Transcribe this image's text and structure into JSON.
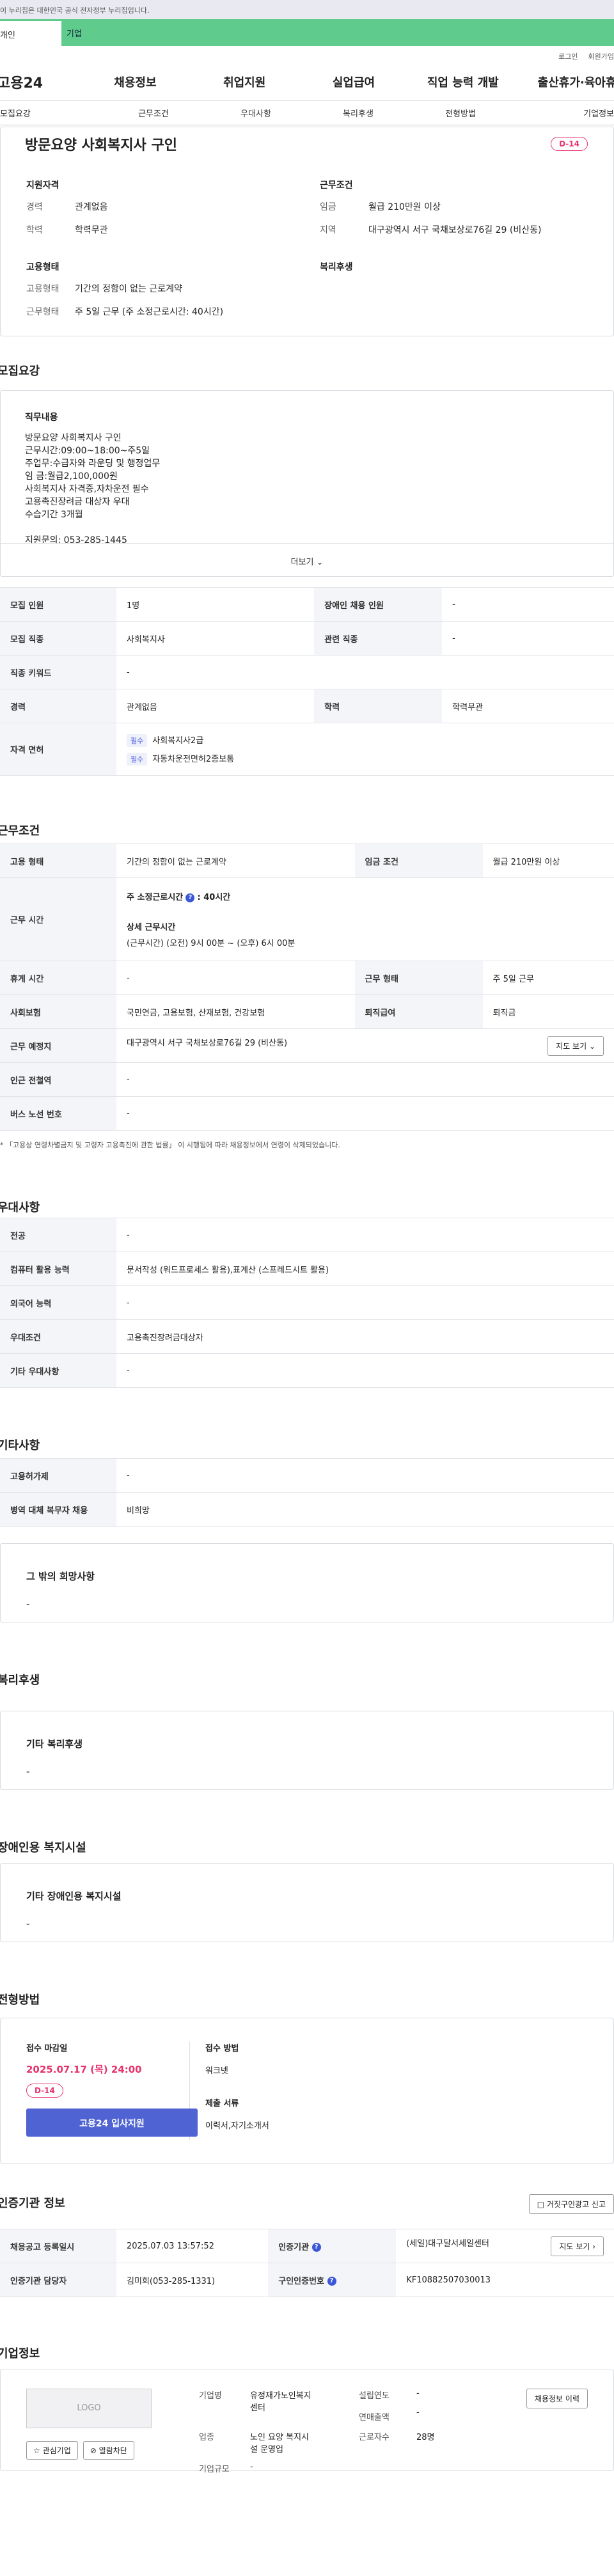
{
  "gov_banner": "이 누리집은 대한민국 공식 전자정부 누리집입니다.",
  "top_tabs": {
    "personal": "개인",
    "company": "기업"
  },
  "util": {
    "login": "로그인",
    "join": "회원가입"
  },
  "gnb": {
    "logo": "고용24",
    "items": [
      "채용정보",
      "취업지원",
      "실업급여",
      "직업 능력 개발",
      "출산휴가·육아휴직"
    ]
  },
  "subnav": [
    "모집요강",
    "근무조건",
    "우대사항",
    "복리후생",
    "전형방법",
    "기업정보"
  ],
  "job": {
    "title": "방문요양 사회복지사 구인",
    "dday": "D-14",
    "summary": {
      "qual_h": "지원자격",
      "career_k": "경력",
      "career_v": "관계없음",
      "edu_k": "학력",
      "edu_v": "학력무관",
      "cond_h": "근무조건",
      "wage_k": "임금",
      "wage_v": "월급 210만원 이상",
      "area_k": "지역",
      "area_v": "대구광역시 서구 국채보상로76길 29 (비산동)",
      "emp_h": "고용형태",
      "type_k": "고용형태",
      "type_v": "기간의 정함이 없는 근로계약",
      "hours_k": "근무형태",
      "hours_v": "주 5일 근무 (주 소정근로시간: 40시간)",
      "welfare_h": "복리후생"
    }
  },
  "recruit": {
    "title": "모집요강",
    "duty_h": "직무내용",
    "duty_lines": [
      "방문요양 사회복지사 구인",
      "근무시간:09:00~18:00~주5일",
      "주업무:수급자와 라운딩 및 행정업무",
      "임  금:월급2,100,000원",
      "사회복지사 자격증,자차운전 필수",
      "고용촉진장려금 대상자 우대",
      "수습기간 3개월",
      "",
      "지원문의: 053-285-1445"
    ],
    "more": "더보기",
    "rows": [
      [
        "모집 인원",
        "1명",
        "장애인 채용 인원",
        "-"
      ],
      [
        "모집 직종",
        "사회복지사",
        "관련 직종",
        "-"
      ],
      [
        "직종 키워드",
        "-"
      ],
      [
        "경력",
        "관계없음",
        "학력",
        "학력무관"
      ]
    ],
    "license_k": "자격 면허",
    "license_badge": "필수",
    "licenses": [
      "사회복지사2급",
      "자동차운전면허2종보통"
    ]
  },
  "work": {
    "title": "근무조건",
    "emp_type_k": "고용 형태",
    "emp_type_v": "기간의 정함이 없는 근로계약",
    "wage_k": "임금 조건",
    "wage_v": "월급 210만원 이상",
    "time_k": "근무 시간",
    "time_line1": "주 소정근로시간",
    "time_line1_v": ": 40시간",
    "time_h2": "상세 근무시간",
    "time_v2": "(근무시간) (오전) 9시 00분 ~ (오후) 6시 00분",
    "rest_k": "휴게 시간",
    "rest_v": "-",
    "shape_k": "근무 형태",
    "shape_v": "주 5일 근무",
    "ins_k": "사회보험",
    "ins_v": "국민연금, 고용보험, 산재보험, 건강보험",
    "ret_k": "퇴직급여",
    "ret_v": "퇴직금",
    "place_k": "근무 예정지",
    "place_v": "대구광역시 서구 국채보상로76길 29 (비산동)",
    "map_btn": "지도 보기",
    "sub_k": "인근 전철역",
    "sub_v": "-",
    "bus_k": "버스 노선 번호",
    "bus_v": "-",
    "note": "* 「고용상 연령차별금지 및 고령자 고용촉진에 관한 법률」 이 시행됨에 따라 채용정보에서 연령이 삭제되었습니다."
  },
  "pref": {
    "title": "우대사항",
    "rows": [
      [
        "전공",
        "-"
      ],
      [
        "컴퓨터 활용 능력",
        "문서작성 (워드프로세스 활용),표계산 (스프레드시트 활용)"
      ],
      [
        "외국어 능력",
        "-"
      ],
      [
        "우대조건",
        "고용촉진장려금대상자"
      ],
      [
        "기타 우대사항",
        "-"
      ]
    ]
  },
  "etc": {
    "title": "기타사항",
    "rows": [
      [
        "고용허가제",
        "-"
      ],
      [
        "병역 대체 복무자 채용",
        "비희망"
      ]
    ],
    "hope_h": "그 밖의 희망사항",
    "hope_v": "-"
  },
  "welfare": {
    "title": "복리후생",
    "h": "기타 복리후생",
    "v": "-"
  },
  "disabled": {
    "title": "장애인용 복지시설",
    "h": "기타 장애인용 복지시설",
    "v": "-"
  },
  "apply": {
    "title": "전형방법",
    "deadline_h": "접수 마감일",
    "deadline_v": "2025.07.17 (목) 24:00",
    "dday": "D-14",
    "btn": "고용24 입사지원",
    "method_h": "접수 방법",
    "method_v": "워크넷",
    "docs_h": "제출 서류",
    "docs_v": "이력서,자기소개서"
  },
  "agency": {
    "title": "인증기관 정보",
    "share_btn": "거짓구인광고 신고",
    "reg_k": "채용공고 등록일시",
    "reg_v": "2025.07.03 13:57:52",
    "org_k": "인증기관",
    "org_v": "(세일)대구달서세일센터",
    "map_btn": "지도 보기",
    "mgr_k": "인증기관 담당자",
    "mgr_v": "김미희(053-285-1331)",
    "no_k": "구인인증번호",
    "no_v": "KF10882507030013"
  },
  "company": {
    "title": "기업정보",
    "logo": "LOGO",
    "interest": "관심기업",
    "block": "열람차단",
    "info_btn": "채용정보 이력",
    "name_k": "기업명",
    "name_v1": "유정재가노인복지",
    "name_v2": "센터",
    "ind_k": "업종",
    "ind_v1": "노인 요양 복지시",
    "ind_v2": "설 운영업",
    "size_k": "기업규모",
    "size_v": "-",
    "est_k": "설립연도",
    "est_v": "-",
    "sales_k": "연매출액",
    "sales_v": "-",
    "emp_k": "근로자수",
    "emp_v": "28명"
  }
}
